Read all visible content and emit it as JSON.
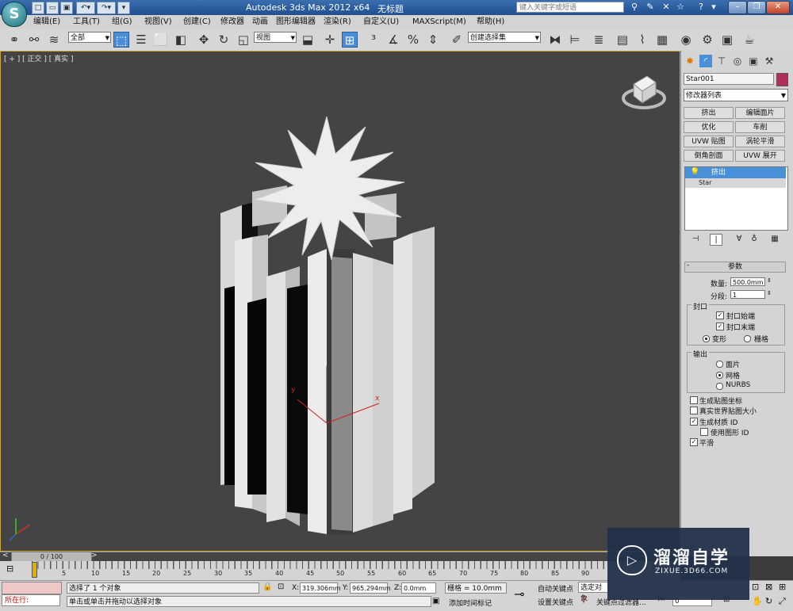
{
  "titlebar": {
    "title": "Autodesk 3ds Max  2012 x64",
    "document": "无标题",
    "search_placeholder": "键入关键字或短语"
  },
  "menu": [
    "编辑(E)",
    "工具(T)",
    "组(G)",
    "视图(V)",
    "创建(C)",
    "修改器",
    "动画",
    "图形编辑器",
    "渲染(R)",
    "自定义(U)",
    "MAXScript(M)",
    "帮助(H)"
  ],
  "toolbar": {
    "selection_filter": "全部",
    "reference_coord": "视图",
    "named_selection": "创建选择集"
  },
  "viewport": {
    "label": "[ + ] [ 正交 ] [ 真实 ]",
    "gizmo_x": "x",
    "gizmo_y": "y"
  },
  "cmd_panel": {
    "object_name": "Star001",
    "object_color": "#b0305a",
    "modifier_list": "修改器列表",
    "modifier_buttons": [
      "挤出",
      "编辑面片",
      "优化",
      "车削",
      "UVW 贴图",
      "涡轮平滑",
      "倒角剖面",
      "UVW 展开"
    ],
    "stack": [
      "挤出",
      "Star"
    ],
    "params": {
      "title": "参数",
      "amount_label": "数量:",
      "amount": "500.0mm",
      "segments_label": "分段:",
      "segments": "1",
      "capping_title": "封口",
      "cap_start": "封口始端",
      "cap_end": "封口末端",
      "morph": "变形",
      "grid": "栅格",
      "output_title": "输出",
      "patch": "面片",
      "mesh": "网格",
      "nurbs": "NURBS",
      "gen_mapping": "生成贴图坐标",
      "real_world": "真实世界贴图大小",
      "gen_mat_ids": "生成材质 ID",
      "use_shape_ids": "使用图形 ID",
      "smooth": "平滑"
    }
  },
  "timeline": {
    "frame": "0 / 100",
    "ticks": [
      "5",
      "10",
      "15",
      "20",
      "25",
      "30",
      "35",
      "40",
      "45",
      "50",
      "55",
      "60",
      "65",
      "70",
      "75",
      "80",
      "85",
      "90"
    ]
  },
  "status": {
    "running": "所在行:",
    "selected": "选择了 1 个对象",
    "prompt": "单击或单击并拖动以选择对象",
    "x_label": "X:",
    "x": "319.306mm",
    "y_label": "Y:",
    "y": "965.294mm",
    "z_label": "Z:",
    "z": "0.0mm",
    "grid": "栅格 = 10.0mm",
    "add_time_tag": "添加时间标记",
    "auto_key": "自动关键点",
    "set_key": "设置关键点",
    "selected_obj": "选定对象",
    "key_filters": "关键点过滤器...",
    "frame_field": "0"
  },
  "watermark": {
    "brand": "溜溜自学",
    "url": "ZIXUE.3D66.COM"
  }
}
